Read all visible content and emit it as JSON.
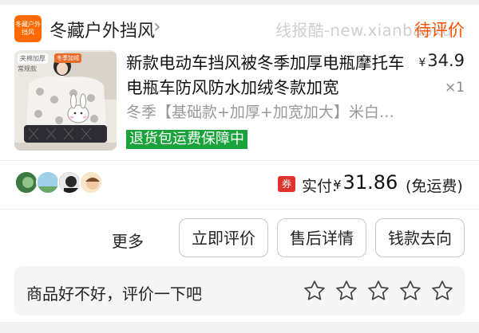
{
  "store": {
    "logo_text": "冬藏户外挡风",
    "name": "冬藏户外挡风",
    "chevron": "›"
  },
  "watermark": "线报酷-new.xianbaoku",
  "order_status": "待评价",
  "product": {
    "thumb_tags": [
      "夹棉加厚",
      "常规款",
      "冬季加绒"
    ],
    "title": "新款电动车挡风被冬季加厚电瓶摩托车电瓶车防风防水加绒冬款加宽",
    "price_symbol": "¥",
    "price": "34.9",
    "quantity": "×1",
    "spec": "冬季【基础款+加厚+加宽加大】米白…",
    "badge": "退货包运费保障中"
  },
  "payment": {
    "voucher_icon_text": "券",
    "label": "实付:",
    "symbol": "¥",
    "amount": "31.86",
    "note": "(免运费)"
  },
  "actions": {
    "more": "更多",
    "review": "立即评价",
    "after_sales": "售后详情",
    "refund_status": "钱款去向"
  },
  "review_bar": {
    "prompt": "商品好不好，评价一下吧",
    "stars": 5
  },
  "colors": {
    "status_orange": "#ff5000",
    "badge_green": "#1aa33b",
    "voucher_red": "#e0332d"
  }
}
